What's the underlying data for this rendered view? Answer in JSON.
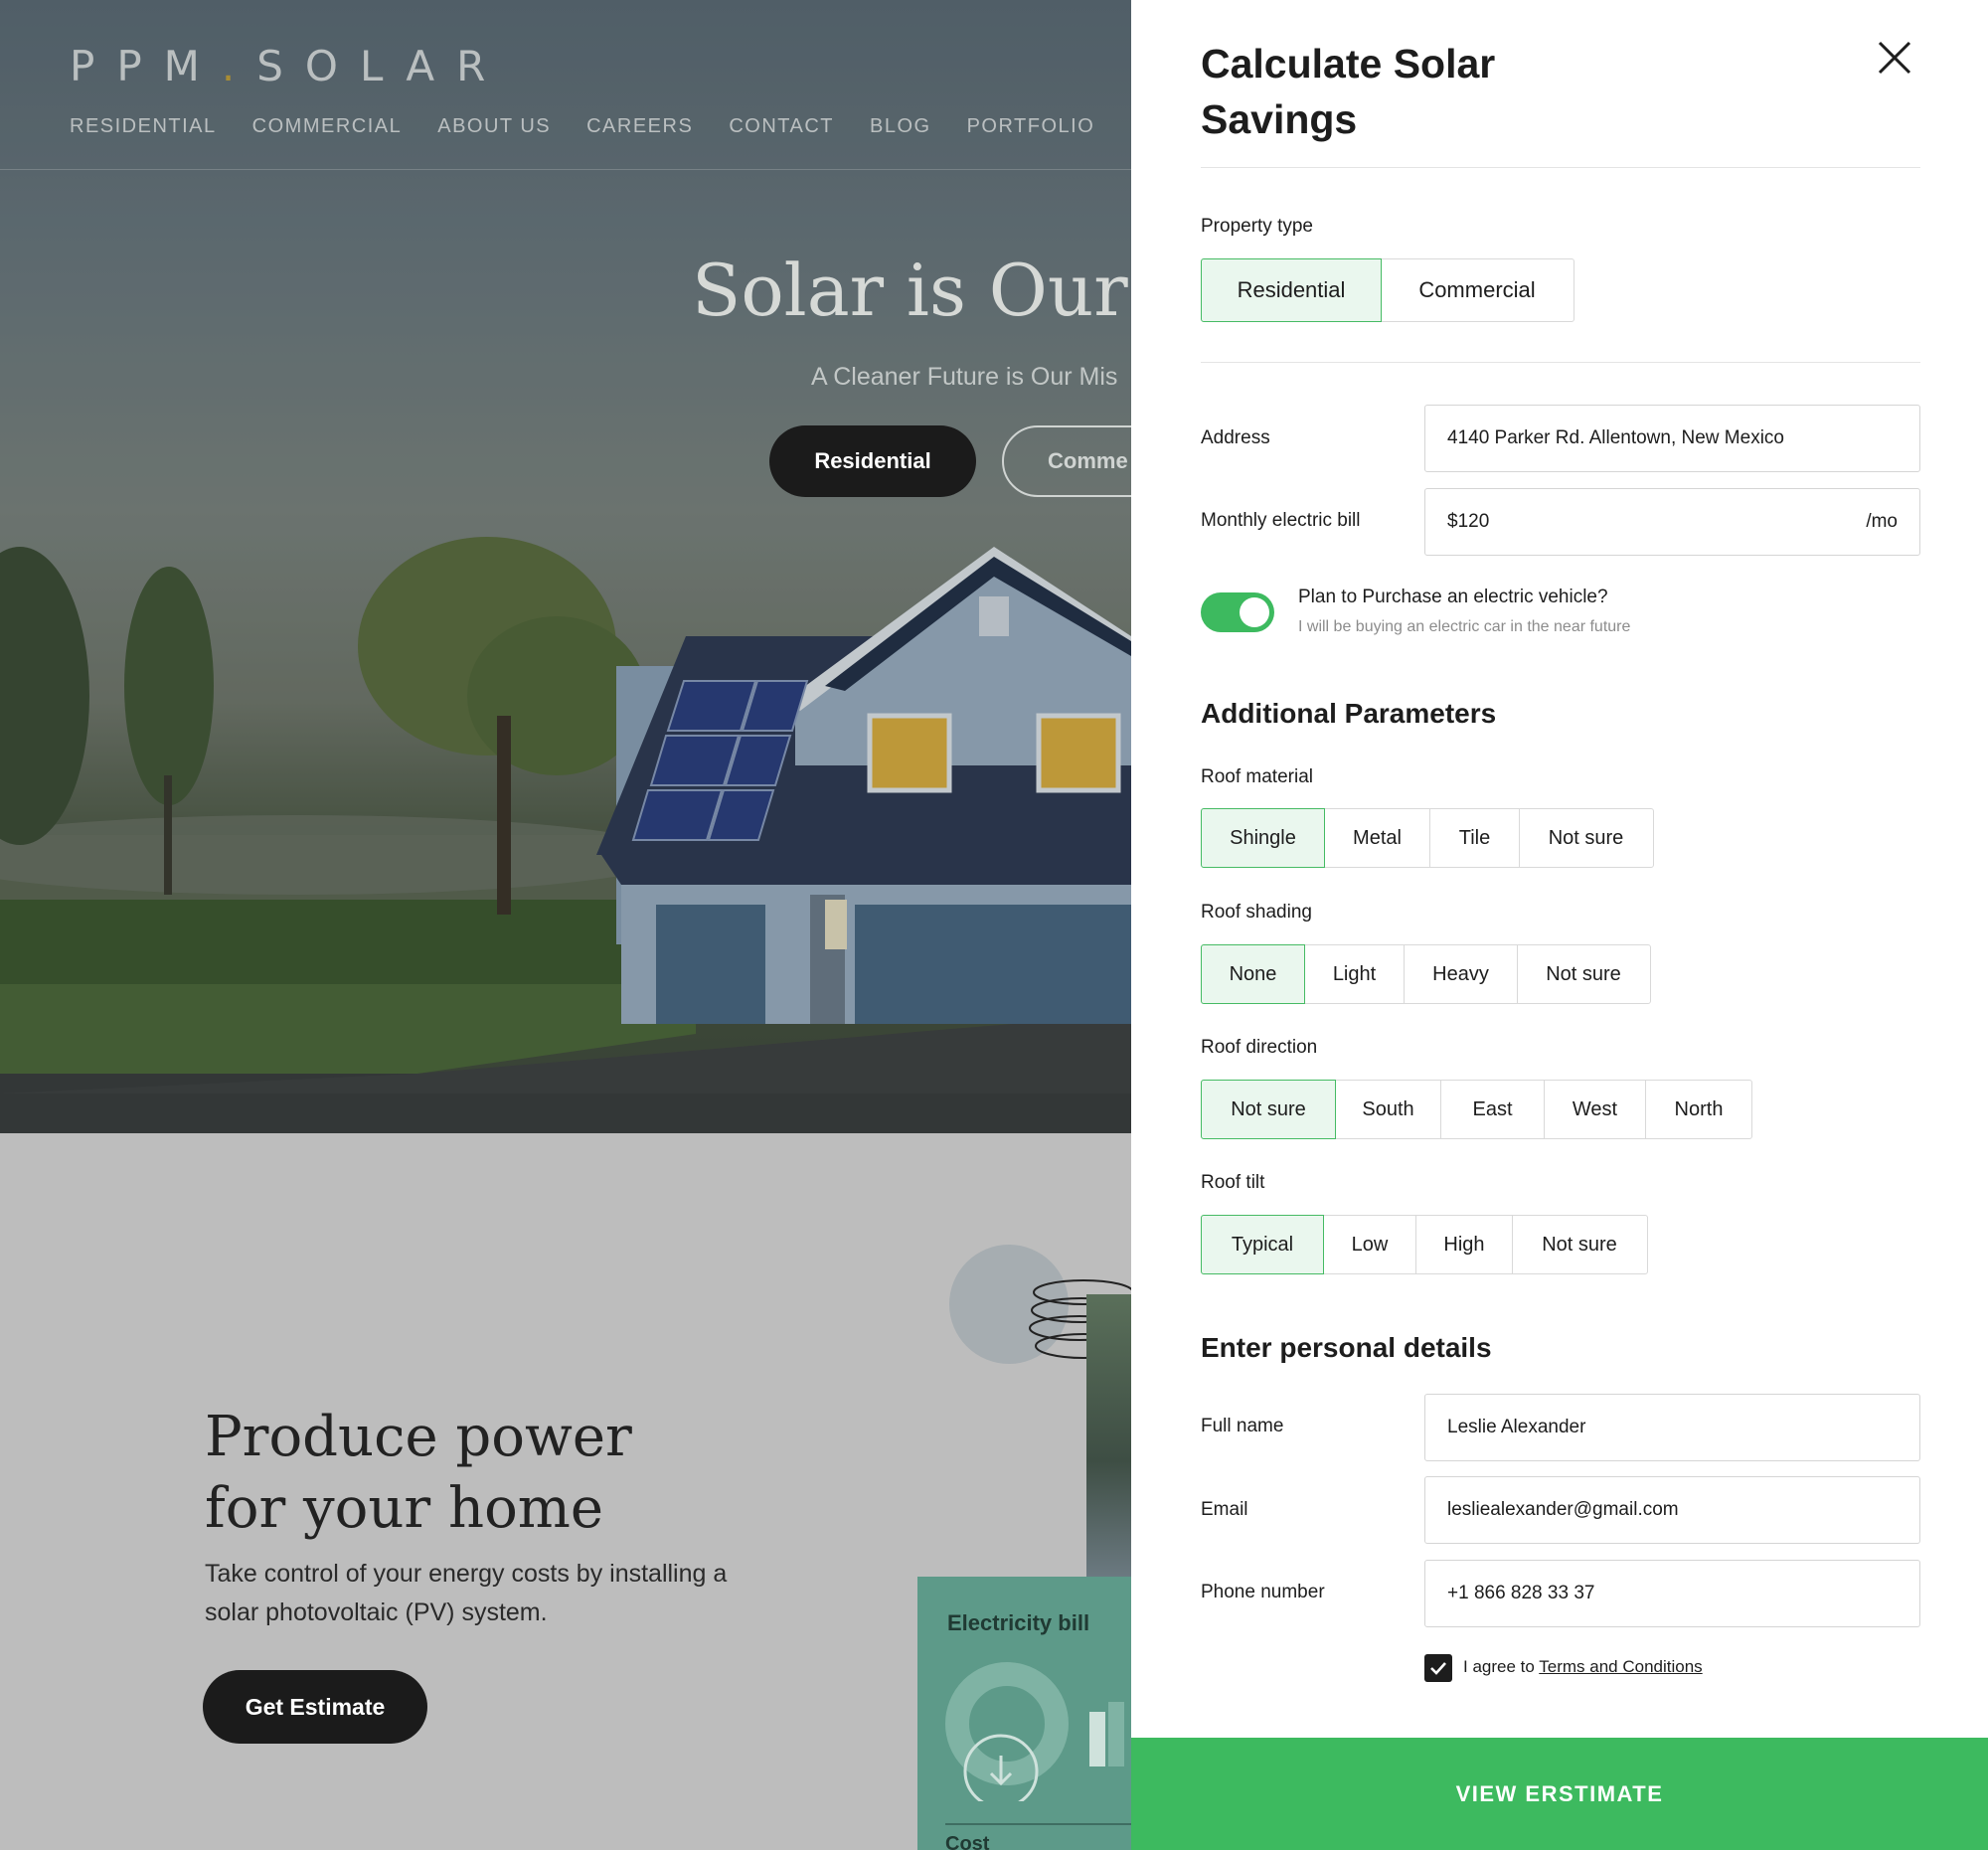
{
  "site": {
    "logo_left": "PPM",
    "logo_dot": ".",
    "logo_right": "SOLAR",
    "nav": [
      "RESIDENTIAL",
      "COMMERCIAL",
      "ABOUT US",
      "CAREERS",
      "CONTACT",
      "BLOG",
      "PORTFOLIO"
    ],
    "hero_title": "Solar is Our Pa",
    "hero_subtitle": "A Cleaner Future is Our Mis",
    "hero_btn_primary": "Residential",
    "hero_btn_secondary": "Comme",
    "produce_title_line1": "Produce power",
    "produce_title_line2": "for your home",
    "produce_copy": "Take control of your energy costs by installing a solar photovoltaic (PV) system.",
    "get_estimate": "Get Estimate",
    "bill_card_title": "Electricity bill",
    "bill_card_cost": "Cost"
  },
  "panel": {
    "title": "Calculate Solar Savings",
    "property_type": {
      "label": "Property type",
      "options": [
        "Residential",
        "Commercial"
      ],
      "selected": "Residential"
    },
    "address": {
      "label": "Address",
      "value": "4140 Parker Rd. Allentown, New Mexico"
    },
    "bill": {
      "label": "Monthly electric bill",
      "value": "$120",
      "suffix": "/mo"
    },
    "ev": {
      "title": "Plan to Purchase an electric vehicle?",
      "subtitle": "I will be buying an electric car in the near future",
      "on": true
    },
    "additional_title": "Additional Parameters",
    "roof_material": {
      "label": "Roof material",
      "options": [
        "Shingle",
        "Metal",
        "Tile",
        "Not sure"
      ],
      "selected": "Shingle"
    },
    "roof_shading": {
      "label": "Roof shading",
      "options": [
        "None",
        "Light",
        "Heavy",
        "Not sure"
      ],
      "selected": "None"
    },
    "roof_direction": {
      "label": "Roof direction",
      "options": [
        "Not sure",
        "South",
        "East",
        "West",
        "North"
      ],
      "selected": "Not sure"
    },
    "roof_tilt": {
      "label": "Roof tilt",
      "options": [
        "Typical",
        "Low",
        "High",
        "Not sure"
      ],
      "selected": "Typical"
    },
    "personal_title": "Enter personal details",
    "full_name": {
      "label": "Full name",
      "value": "Leslie Alexander"
    },
    "email": {
      "label": "Email",
      "value": "lesliealexander@gmail.com"
    },
    "phone": {
      "label": "Phone number",
      "value": "+1 866 828 33 37"
    },
    "agree_prefix": "I agree to",
    "agree_link": "Terms and Conditions",
    "agree_checked": true,
    "cta": "VIEW ERSTIMATE"
  },
  "colors": {
    "accent_green": "#3dba5f",
    "selected_bg": "#eaf7ee",
    "dark_button": "#1b1b1b"
  }
}
